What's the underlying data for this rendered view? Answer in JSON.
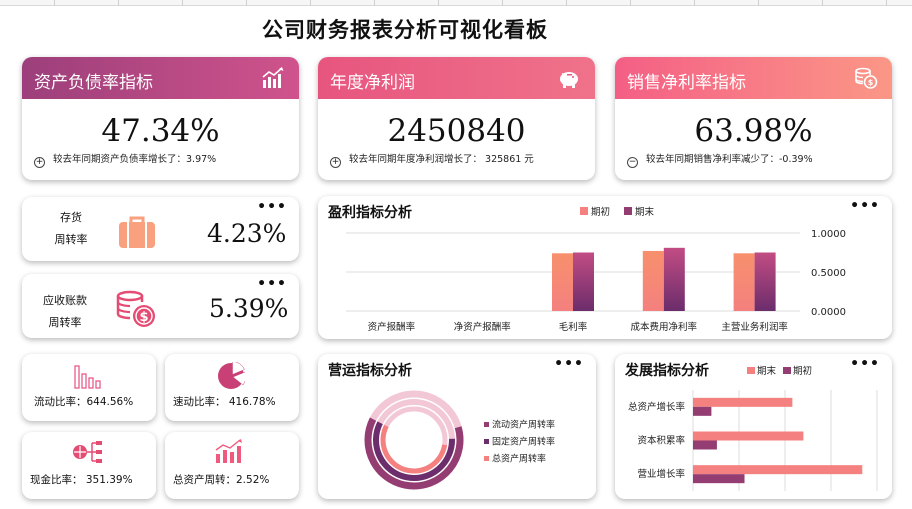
{
  "page_title": "公司财务报表分析可视化看板",
  "colors": {
    "pink": "#f4807f",
    "plum": "#943d73",
    "purple_grad_start": "#9c3f7b",
    "purple_grad_end": "#d0538c",
    "pink_grad_start": "#e7557f",
    "pink_grad_end": "#f0728a",
    "salmon_grad_start": "#f45f85",
    "salmon_grad_end": "#fb9786"
  },
  "kpis": {
    "debt_ratio": {
      "title": "资产负债率指标",
      "value": "47.34%",
      "sign": "+",
      "note": "较去年同期资产负债率增长了：3.97%",
      "icon": "bar-chart-up-icon"
    },
    "net_profit": {
      "title": "年度净利润",
      "value": "2450840",
      "sign": "+",
      "note": "较去年同期年度净利润增长了： 325861 元",
      "icon": "piggy-bank-icon"
    },
    "net_margin": {
      "title": "销售净利率指标",
      "value": "63.98%",
      "sign": "−",
      "note": "较去年同期销售净利率减少了：-0.39%",
      "icon": "coin-stack-icon"
    }
  },
  "turnover": {
    "inventory": {
      "label_line1": "存货",
      "label_line2": "周转率",
      "value": "4.23%",
      "icon": "briefcase-icon"
    },
    "receivable": {
      "label_line1": "应收账款",
      "label_line2": "周转率",
      "value": "5.39%",
      "icon": "coin-dollar-icon"
    }
  },
  "ratios": {
    "current": {
      "label": "流动比率：644.56%",
      "icon": "bar-outline-icon"
    },
    "quick": {
      "label": "速动比率： 416.78%",
      "icon": "pie-icon"
    },
    "cash": {
      "label": "现金比率： 351.39%",
      "icon": "network-icon"
    },
    "asset_turnover": {
      "label": "总资产周转：2.52%",
      "icon": "bar-growth-icon"
    }
  },
  "more_label": "•••",
  "chart_data": [
    {
      "id": "profit",
      "type": "bar",
      "title": "盈利指标分析",
      "categories": [
        "资产报酬率",
        "净资产报酬率",
        "毛利率",
        "成本费用净利率",
        "主营业务利润率"
      ],
      "series": [
        {
          "name": "期初",
          "values": [
            0,
            0,
            0.74,
            0.77,
            0.74
          ],
          "color": "#f4807f"
        },
        {
          "name": "期末",
          "values": [
            0,
            0,
            0.75,
            0.81,
            0.75
          ],
          "color": "#943d73"
        }
      ],
      "y_ticks": [
        "1.0000",
        "0.5000",
        "0.0000"
      ],
      "ylim": [
        0,
        1
      ],
      "legend_position": "top-right",
      "grid": true
    },
    {
      "id": "operation",
      "type": "pie",
      "title": "营运指标分析",
      "series": [
        {
          "name": "流动资产周转率",
          "values": [
            0.38,
            0.62
          ],
          "color": "#943d73"
        },
        {
          "name": "固定资产周转率",
          "values": [
            0.42,
            0.58
          ],
          "color": "#6b2d6b"
        },
        {
          "name": "总资产周转率",
          "values": [
            0.45,
            0.55
          ],
          "color": "#f4807f"
        }
      ],
      "legend_position": "right"
    },
    {
      "id": "growth",
      "type": "bar",
      "orientation": "horizontal",
      "title": "发展指标分析",
      "categories": [
        "总资产增长率",
        "资本积累率",
        "营业增长率"
      ],
      "series": [
        {
          "name": "期末",
          "values": [
            0.54,
            0.6,
            0.92
          ],
          "color": "#f4807f"
        },
        {
          "name": "期初",
          "values": [
            0.1,
            0.13,
            0.28
          ],
          "color": "#943d73"
        }
      ],
      "xlim": [
        0,
        1
      ],
      "legend_position": "top",
      "grid": true
    }
  ]
}
